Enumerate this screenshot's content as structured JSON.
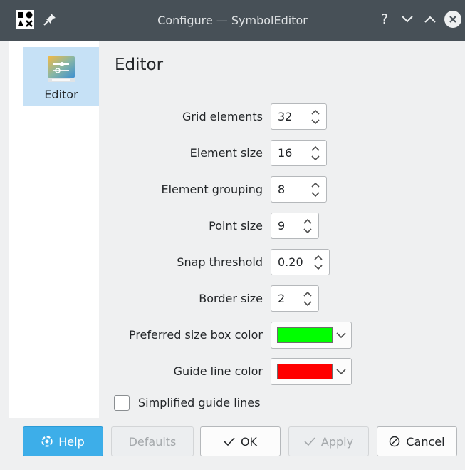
{
  "window": {
    "title": "Configure — SymbolEditor"
  },
  "sidebar": {
    "items": [
      {
        "label": "Editor",
        "icon": "editor-settings-icon",
        "selected": true
      }
    ]
  },
  "page": {
    "title": "Editor"
  },
  "fields": [
    {
      "label": "Grid elements",
      "value": "32"
    },
    {
      "label": "Element size",
      "value": "16"
    },
    {
      "label": "Element grouping",
      "value": "8"
    },
    {
      "label": "Point size",
      "value": "9"
    },
    {
      "label": "Snap threshold",
      "value": "0.20"
    },
    {
      "label": "Border size",
      "value": "2"
    }
  ],
  "colors": [
    {
      "label": "Preferred size box color",
      "value": "#00ff00"
    },
    {
      "label": "Guide line color",
      "value": "#ff0000"
    }
  ],
  "checkbox": {
    "label": "Simplified guide lines",
    "checked": false
  },
  "buttons": {
    "help": "Help",
    "defaults": "Defaults",
    "ok": "OK",
    "apply": "Apply",
    "cancel": "Cancel"
  },
  "theme": {
    "accent": "#3daee9",
    "titlebar": "#475057",
    "selection": "#c6e1f6"
  }
}
